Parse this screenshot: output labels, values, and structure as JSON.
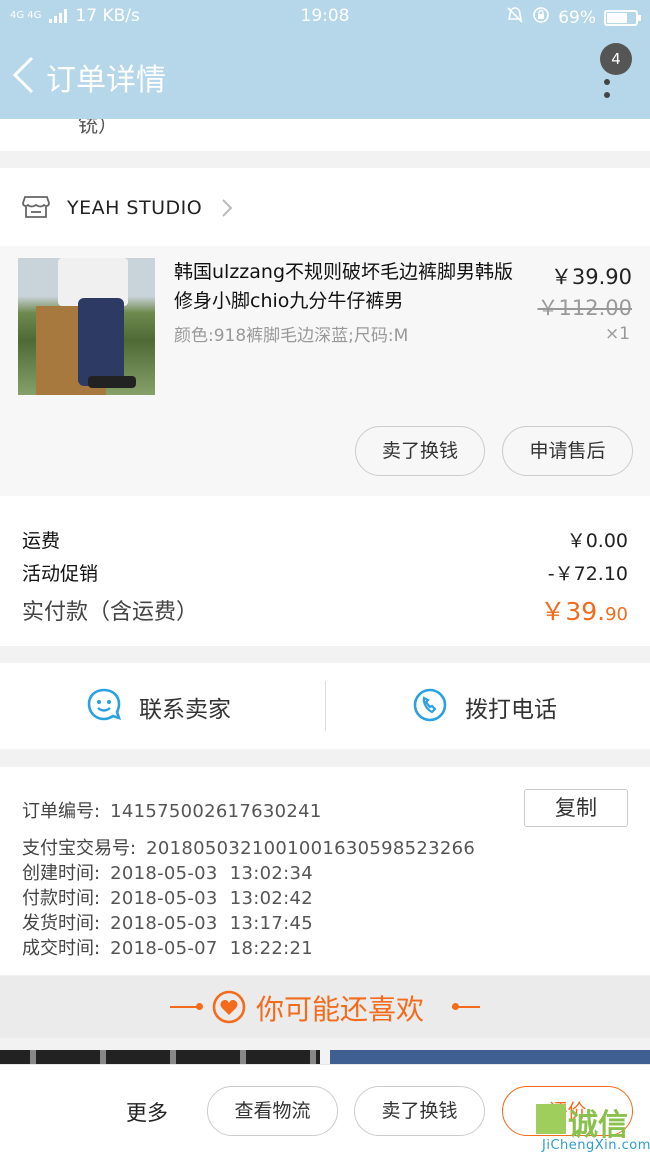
{
  "status_bar": {
    "network": "4G 4G",
    "speed": "17 KB/s",
    "time": "19:08",
    "battery": "69%"
  },
  "nav": {
    "title": "订单详情",
    "badge_count": "4"
  },
  "partial_top_text": "铳）",
  "shop": {
    "name": "YEAH STUDIO"
  },
  "item": {
    "title": "韩国ulzzang不规则破坏毛边裤脚男韩版修身小脚chio九分牛仔裤男",
    "spec": "颜色:918裤脚毛边深蓝;尺码:M",
    "price": "￥39.90",
    "original_price": "￥112.00",
    "quantity": "×1",
    "resell_label": "卖了换钱",
    "after_sale_label": "申请售后"
  },
  "fees": {
    "shipping_label": "运费",
    "shipping_value": "￥0.00",
    "promo_label": "活动促销",
    "promo_value": "-￥72.10",
    "total_label": "实付款（含运费）",
    "total_big": "￥39.",
    "total_small": "90"
  },
  "contact": {
    "seller_label": "联系卖家",
    "call_label": "拨打电话"
  },
  "order_info": {
    "order_no_label": "订单编号:",
    "order_no": "141575002617630241",
    "copy_label": "复制",
    "alipay_label": "支付宝交易号:",
    "alipay_no": "2018050321001001630598523266",
    "created_label": "创建时间:",
    "created": "2018-05-03  13:02:34",
    "paid_label": "付款时间:",
    "paid": "2018-05-03  13:02:42",
    "shipped_label": "发货时间:",
    "shipped": "2018-05-03  13:17:45",
    "closed_label": "成交时间:",
    "closed": "2018-05-07  18:22:21"
  },
  "recommend": {
    "title": "你可能还喜欢"
  },
  "bottom_bar": {
    "more_label": "更多",
    "logistics_label": "查看物流",
    "resell_label": "卖了换钱",
    "rate_label": "评价"
  },
  "watermark": {
    "text": "诚信",
    "url": "JiChengXin.com"
  },
  "colors": {
    "header_bg": "#b6d7ea",
    "accent_orange": "#f36b1c",
    "icon_blue": "#2aa1e0"
  }
}
